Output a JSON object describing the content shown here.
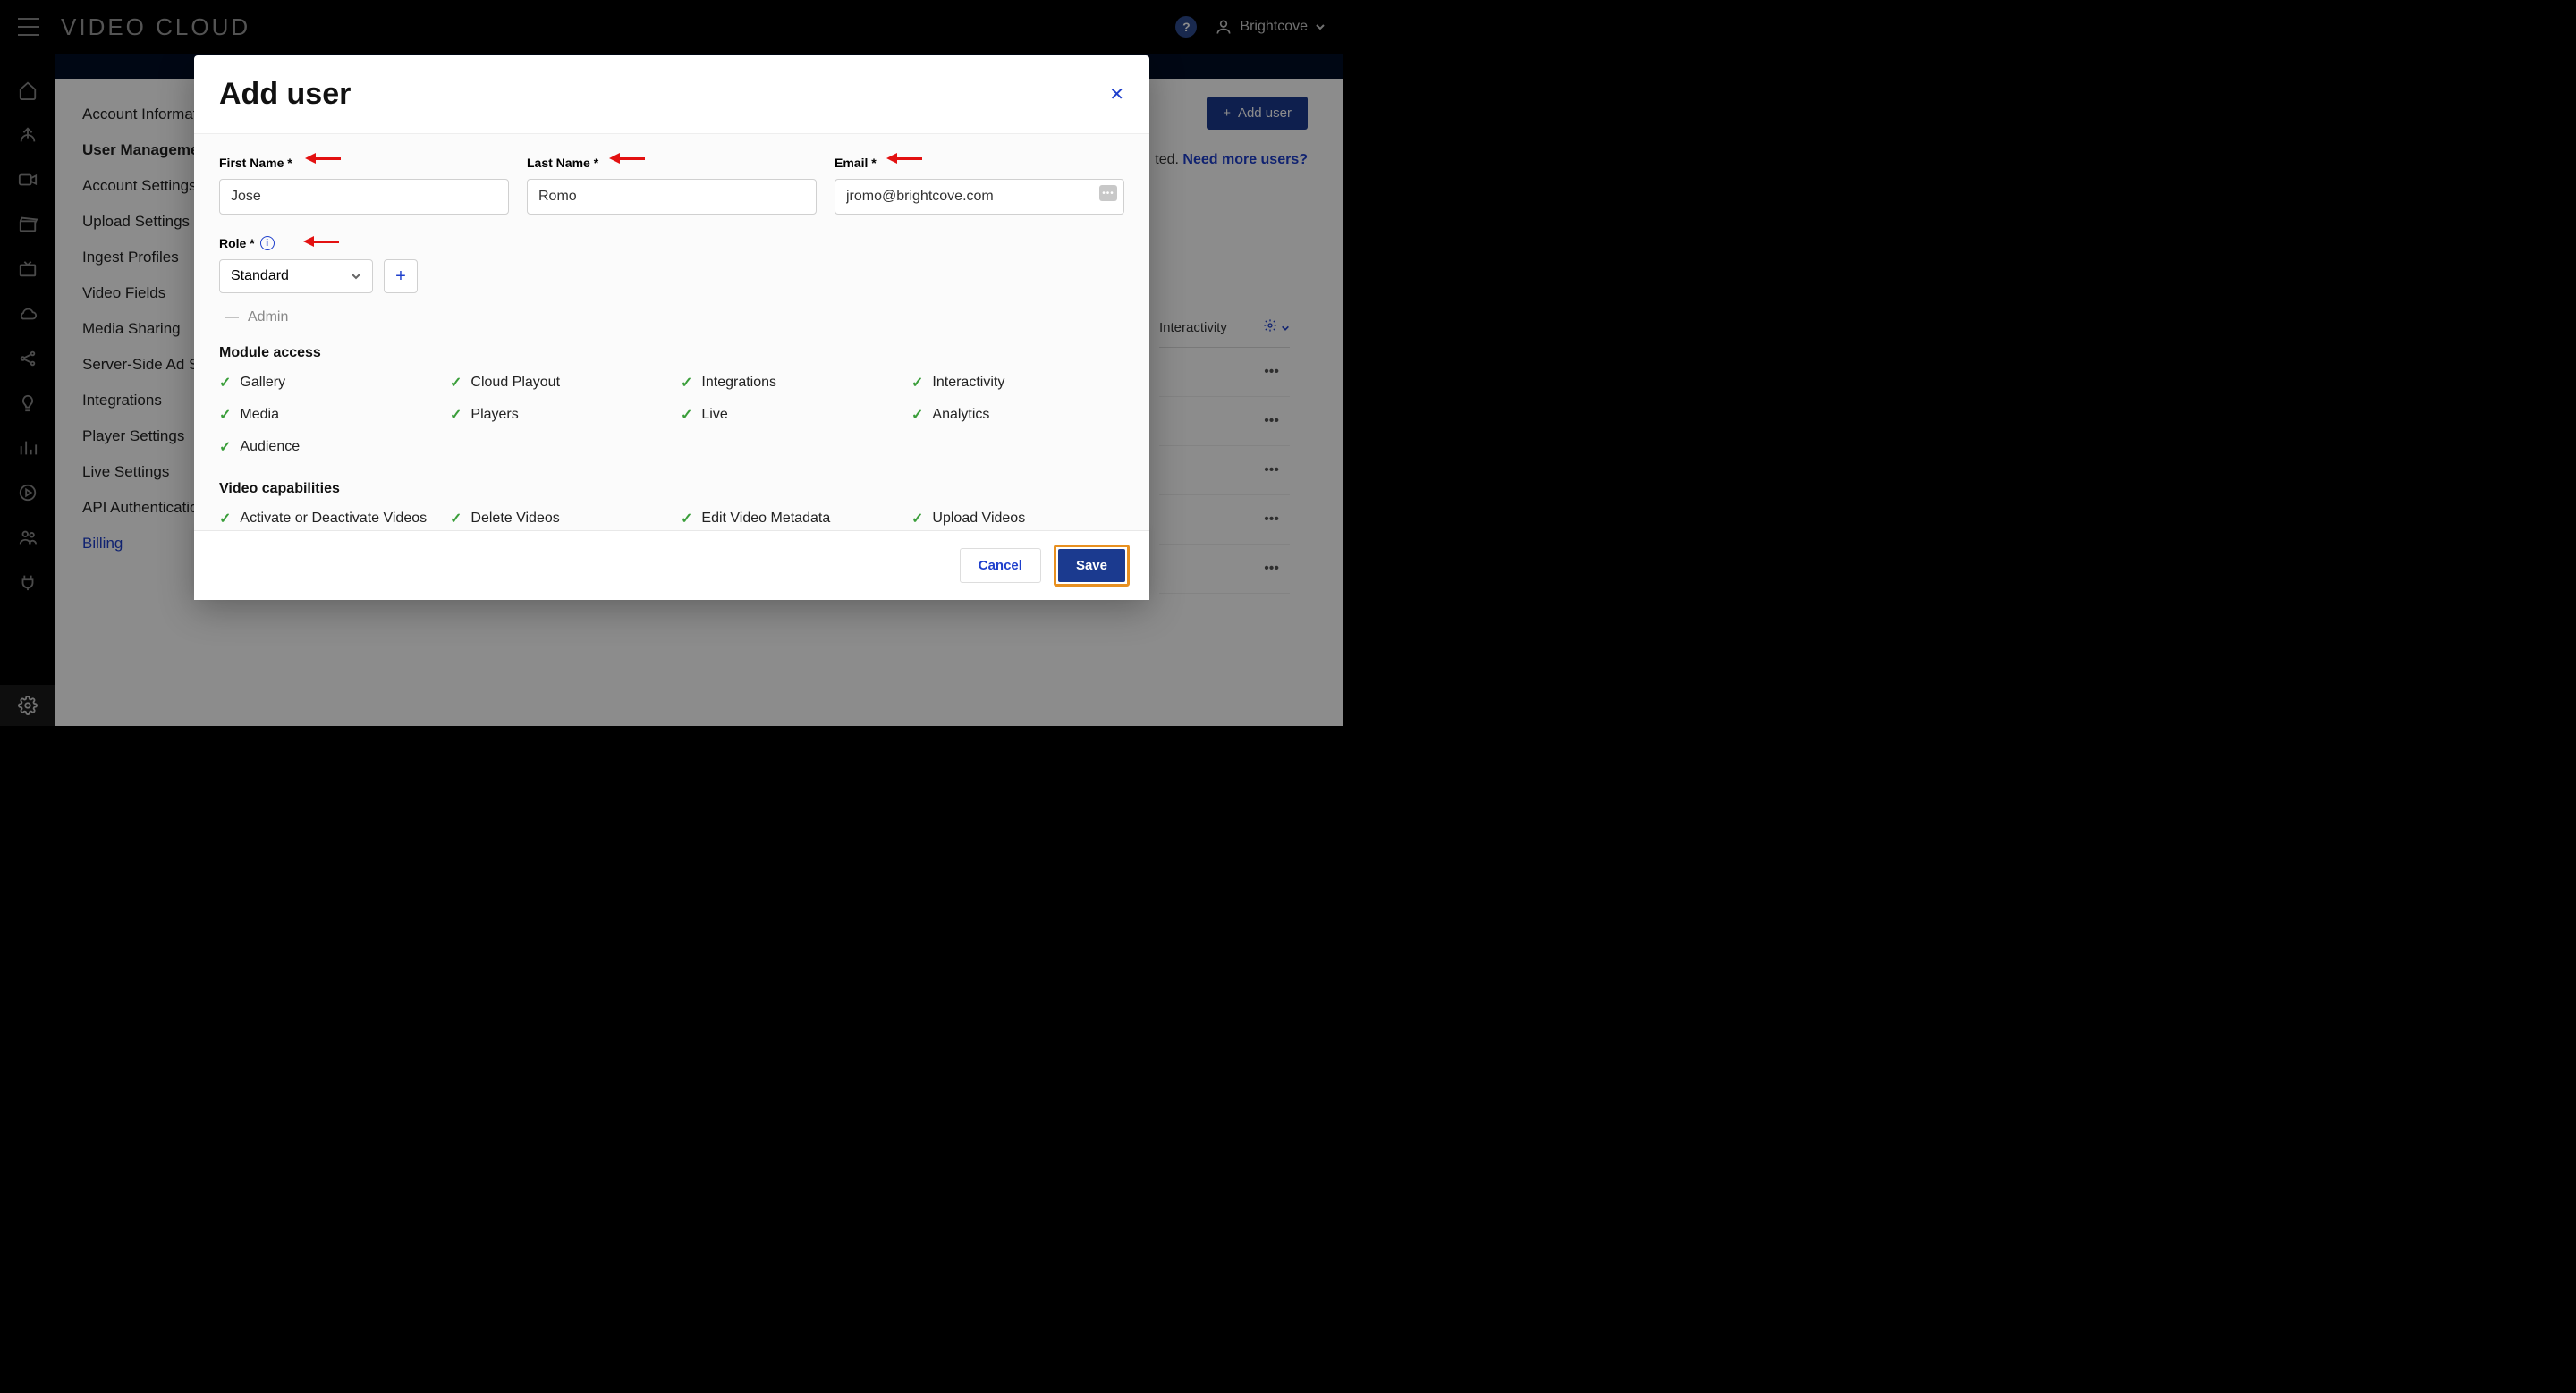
{
  "topbar": {
    "logo": "VIDEO CLOUD",
    "help": "?",
    "username": "Brightcove"
  },
  "settings_nav": [
    "Account Information",
    "User Management",
    "Account Settings",
    "Upload Settings",
    "Ingest Profiles",
    "Video Fields",
    "Media Sharing",
    "Server-Side Ad Settings",
    "Integrations",
    "Player Settings",
    "Live Settings",
    "API Authentication",
    "Billing"
  ],
  "page": {
    "add_user_btn": "Add user",
    "info_suffix": "ted.",
    "need_more": "Need more users?",
    "col_interactivity": "Interactivity"
  },
  "modal": {
    "title": "Add user",
    "labels": {
      "first_name": "First Name *",
      "last_name": "Last Name *",
      "email": "Email *",
      "role": "Role *"
    },
    "values": {
      "first_name": "Jose",
      "last_name": "Romo",
      "email": "jromo@brightcove.com",
      "role": "Standard"
    },
    "admin_label": "Admin",
    "module_access_heading": "Module access",
    "modules": [
      "Gallery",
      "Cloud Playout",
      "Integrations",
      "Interactivity",
      "Media",
      "Players",
      "Live",
      "Analytics",
      "Audience"
    ],
    "video_caps_heading": "Video capabilities",
    "video_caps": [
      "Activate or Deactivate Videos",
      "Delete Videos",
      "Edit Video Metadata",
      "Upload Videos"
    ],
    "cancel": "Cancel",
    "save": "Save"
  }
}
